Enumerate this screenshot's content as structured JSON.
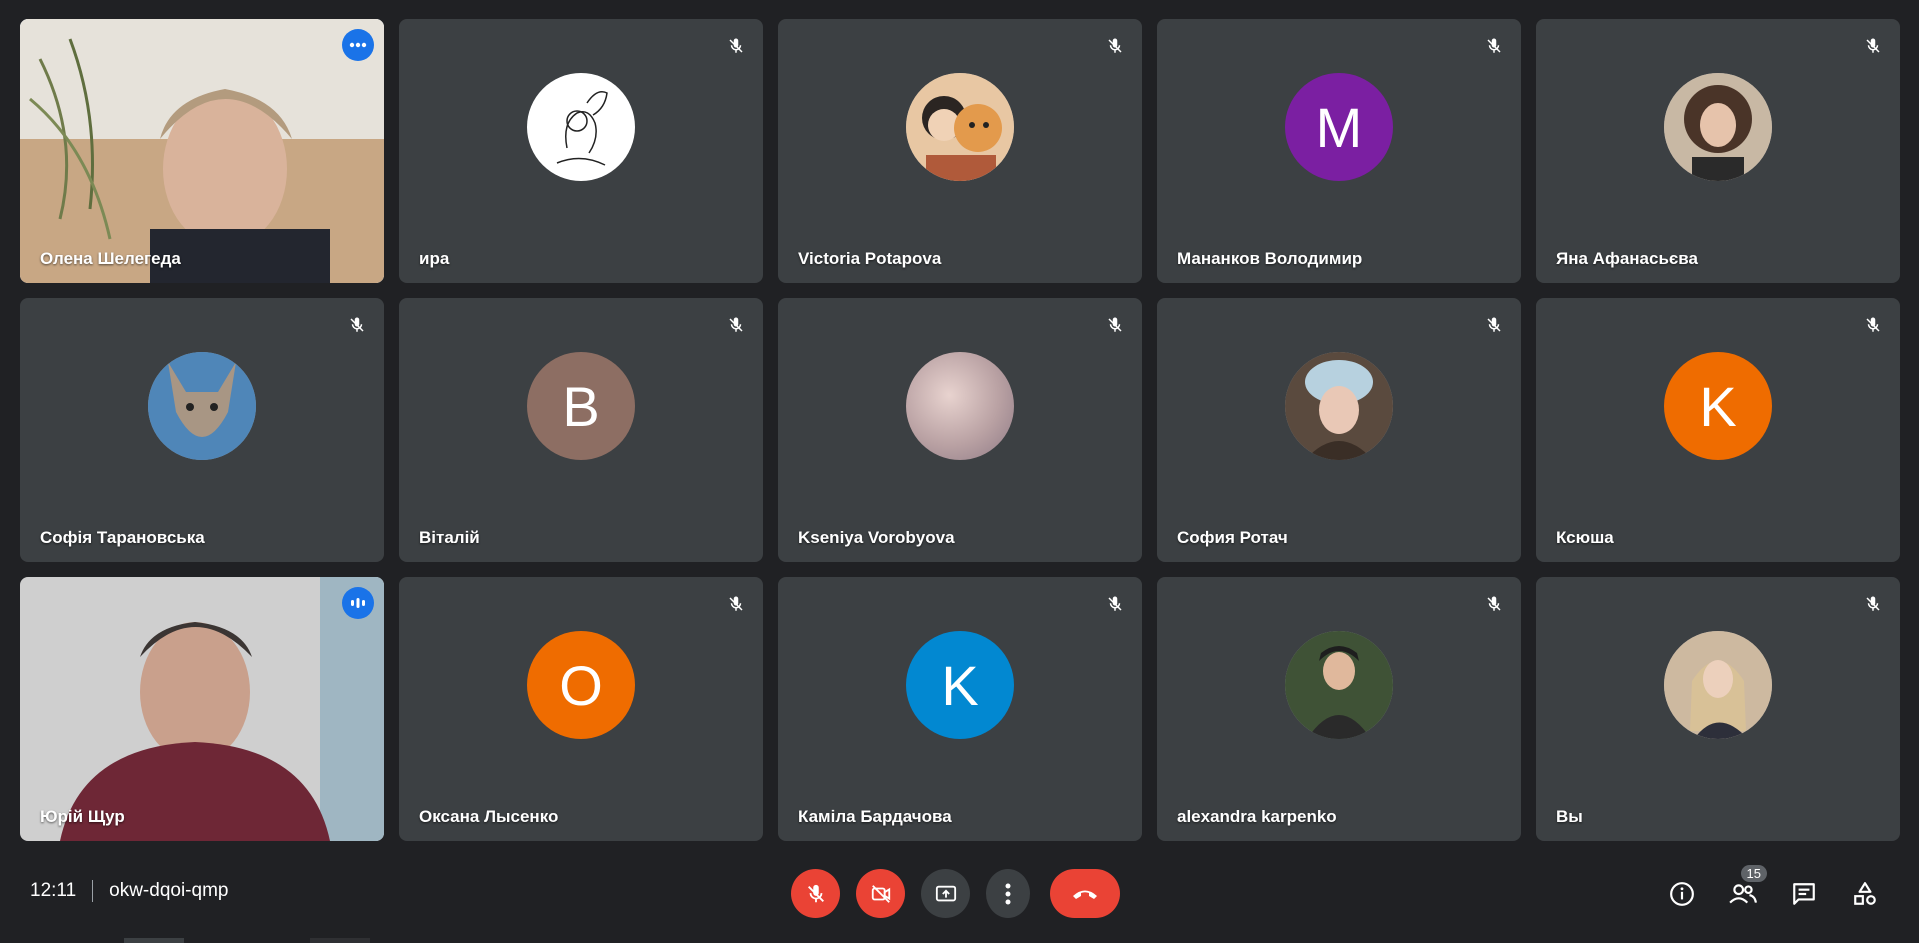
{
  "participants": [
    {
      "name": "Олена Шелегеда",
      "type": "video",
      "badge": "more-options-icon"
    },
    {
      "name": "ира",
      "type": "avatar-photo",
      "avatar_bg": "#ffffff",
      "muted": true
    },
    {
      "name": "Victoria Potapova",
      "type": "avatar-photo",
      "avatar_bg": "#c9a27a",
      "muted": true
    },
    {
      "name": "Мананков Володимир",
      "type": "avatar-letter",
      "letter": "M",
      "avatar_bg": "#7b1fa2",
      "muted": true
    },
    {
      "name": "Яна Афанасьєва",
      "type": "avatar-photo",
      "avatar_bg": "#6d5a4e",
      "muted": true
    },
    {
      "name": "Софія Тарановська",
      "type": "avatar-photo",
      "avatar_bg": "#8a7a6a",
      "muted": true
    },
    {
      "name": "Віталій",
      "type": "avatar-letter",
      "letter": "B",
      "avatar_bg": "#8d6e63",
      "muted": true
    },
    {
      "name": "Kseniya Vorobyova",
      "type": "avatar-photo",
      "avatar_bg": "#b8a4a6",
      "muted": true
    },
    {
      "name": "София Ротач",
      "type": "avatar-photo",
      "avatar_bg": "#7f8a95",
      "muted": true
    },
    {
      "name": "Ксюша",
      "type": "avatar-letter",
      "letter": "K",
      "avatar_bg": "#ef6c00",
      "muted": true
    },
    {
      "name": "Юрій Щур",
      "type": "video",
      "badge": "speaking-indicator-icon"
    },
    {
      "name": "Оксана Лысенко",
      "type": "avatar-letter",
      "letter": "O",
      "avatar_bg": "#ef6c00",
      "muted": true
    },
    {
      "name": "Каміла Бардачова",
      "type": "avatar-letter",
      "letter": "K",
      "avatar_bg": "#0288d1",
      "muted": true
    },
    {
      "name": "alexandra karpenko",
      "type": "avatar-photo",
      "avatar_bg": "#3e4a3a",
      "muted": true
    },
    {
      "name": "Вы",
      "type": "avatar-photo",
      "avatar_bg": "#a08a70",
      "muted": true
    }
  ],
  "meeting": {
    "time": "12:11",
    "code": "okw-dqoi-qmp"
  },
  "controls": {
    "mic": "mic-off-icon",
    "camera": "camera-off-icon",
    "present": "present-screen-icon",
    "more": "more-vert-icon",
    "end": "end-call-icon"
  },
  "right_panel": {
    "info": "info-icon",
    "people": "people-icon",
    "people_count": "15",
    "chat": "chat-icon",
    "activities": "activities-icon"
  },
  "colors": {
    "background": "#202124",
    "tile": "#3c4043",
    "accent_blue": "#1a73e8",
    "end_red": "#ea4335"
  }
}
